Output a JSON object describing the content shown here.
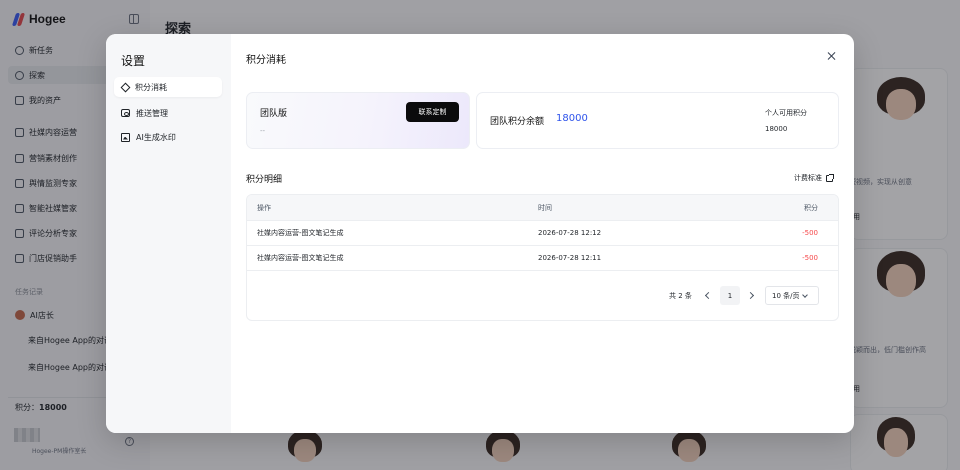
{
  "app": {
    "brand": "Hogee",
    "page_title": "探索",
    "nav": [
      {
        "label": "新任务",
        "icon": "plus-circle-icon"
      },
      {
        "label": "探索",
        "icon": "compass-icon"
      },
      {
        "label": "我的资产",
        "icon": "folder-icon"
      },
      {
        "label": "社媒内容运营",
        "icon": "document-icon"
      },
      {
        "label": "营销素材创作",
        "icon": "image-icon"
      },
      {
        "label": "舆情监测专家",
        "icon": "monitor-icon"
      },
      {
        "label": "智能社媒管家",
        "icon": "document-icon"
      },
      {
        "label": "评论分析专家",
        "icon": "document-icon"
      },
      {
        "label": "门店促销助手",
        "icon": "megaphone-icon"
      }
    ],
    "history_label": "任务记录",
    "history": [
      {
        "label": "AI店长"
      },
      {
        "label": "来自Hogee App的对话"
      },
      {
        "label": "来自Hogee App的对话"
      }
    ],
    "points_label": "积分：",
    "points_value": "18000",
    "user_caption": "Hogee-PM操作室长",
    "bg_cards": [
      {
        "desc": "短视频，实现从创意",
        "btn": "用"
      },
      {
        "desc": "脱颖而出，低门槛创作高",
        "btn": "用"
      }
    ]
  },
  "modal": {
    "title": "设置",
    "menu": [
      {
        "label": "积分消耗",
        "icon": "diamond-icon"
      },
      {
        "label": "推送管理",
        "icon": "push-icon"
      },
      {
        "label": "AI生成水印",
        "icon": "image-icon"
      }
    ],
    "section_title": "积分消耗",
    "plan": {
      "name": "团队版",
      "sub": "--",
      "contact_button": "联系定制"
    },
    "balance": {
      "label": "团队积分余额",
      "value": "18000",
      "personal_label": "个人可用积分",
      "personal_value": "18000"
    },
    "detail_title": "积分明细",
    "billing_link": "计费标准",
    "table": {
      "columns": [
        "操作",
        "时间",
        "积分"
      ],
      "rows": [
        {
          "op": "社媒内容运营-图文笔记生成",
          "time": "2026-07-28 12:12",
          "points": "-500"
        },
        {
          "op": "社媒内容运营-图文笔记生成",
          "time": "2026-07-28 12:11",
          "points": "-500"
        }
      ]
    },
    "pagination": {
      "total": "共 2 条",
      "current_page": "1",
      "page_size": "10 条/页"
    }
  },
  "colors": {
    "accent_blue": "#2f54eb",
    "negative_red": "#f5484a",
    "button_black": "#0b0b0c"
  }
}
